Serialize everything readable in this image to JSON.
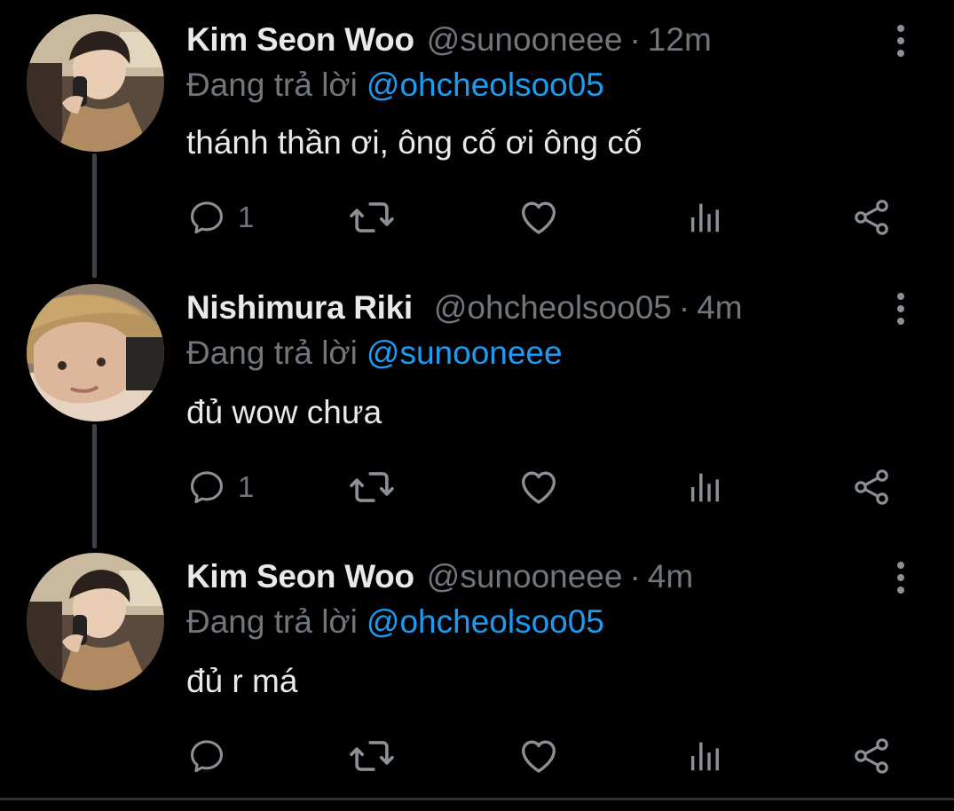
{
  "theme": {
    "background": "#000000",
    "primary_text": "#e7e9ea",
    "secondary_text": "#71767b",
    "accent": "#1d9bf0",
    "thread_line": "#3d4148"
  },
  "tweets": [
    {
      "display_name": "Kim Seon Woo",
      "handle": "@sunooneee",
      "separator": "·",
      "time": "12m",
      "reply_prefix": "Đang trả lời",
      "reply_to": "@ohcheolsoo05",
      "text": "thánh thần ơi, ông cố ơi ông cố",
      "reply_count": "1",
      "avatar": "avatar-kim-seon-woo"
    },
    {
      "display_name": "Nishimura Riki",
      "handle": "@ohcheolsoo05",
      "separator": "·",
      "time": "4m",
      "reply_prefix": "Đang trả lời",
      "reply_to": "@sunooneee",
      "text": "đủ wow chưa",
      "reply_count": "1",
      "avatar": "avatar-nishimura-riki"
    },
    {
      "display_name": "Kim Seon Woo",
      "handle": "@sunooneee",
      "separator": "·",
      "time": "4m",
      "reply_prefix": "Đang trả lời",
      "reply_to": "@ohcheolsoo05",
      "text": "đủ r má",
      "reply_count": "",
      "avatar": "avatar-kim-seon-woo"
    }
  ],
  "icons": {
    "reply": "reply-icon",
    "retweet": "retweet-icon",
    "like": "heart-icon",
    "views": "analytics-icon",
    "share": "share-icon",
    "more": "more-vertical-icon"
  }
}
